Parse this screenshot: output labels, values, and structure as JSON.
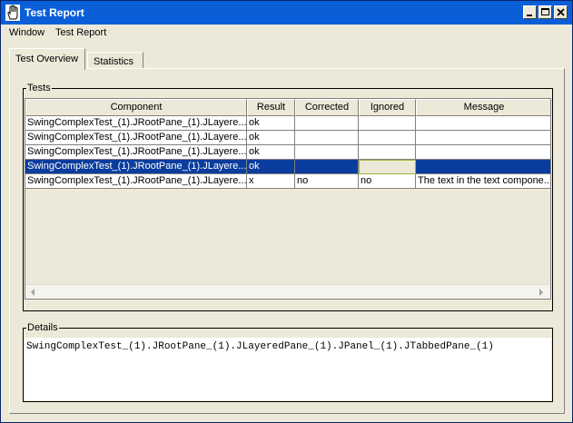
{
  "window": {
    "title": "Test Report"
  },
  "menu": {
    "items": [
      "Window",
      "Test Report"
    ]
  },
  "tabs": [
    {
      "label": "Test Overview",
      "active": true
    },
    {
      "label": "Statistics",
      "active": false
    }
  ],
  "tests": {
    "legend": "Tests",
    "columns": [
      "Component",
      "Result",
      "Corrected",
      "Ignored",
      "Message"
    ],
    "rows": [
      [
        "SwingComplexTest_(1).JRootPane_(1).JLayere...",
        "ok",
        "",
        "",
        ""
      ],
      [
        "SwingComplexTest_(1).JRootPane_(1).JLayere...",
        "ok",
        "",
        "",
        ""
      ],
      [
        "SwingComplexTest_(1).JRootPane_(1).JLayere...",
        "ok",
        "",
        "",
        ""
      ],
      [
        "SwingComplexTest_(1).JRootPane_(1).JLayere...",
        "ok",
        "",
        "",
        ""
      ],
      [
        "SwingComplexTest_(1).JRootPane_(1).JLayere...",
        "x",
        "no",
        "no",
        "The text in the text compone..."
      ]
    ],
    "selected_row": 3
  },
  "details": {
    "legend": "Details",
    "text": "SwingComplexTest_(1).JRootPane_(1).JLayeredPane_(1).JPanel_(1).JTabbedPane_(1)"
  },
  "colors": {
    "titlebar": "#0a5fd8",
    "selection": "#0a3d9e",
    "window_bg": "#ece9d8"
  }
}
